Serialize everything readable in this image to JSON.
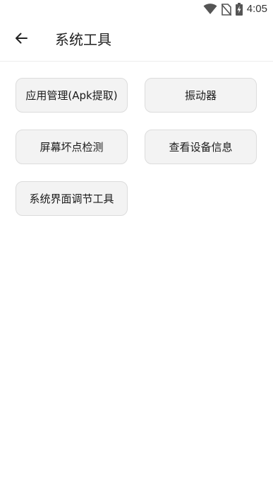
{
  "status_bar": {
    "time": "4:05",
    "icons": [
      "wifi-icon",
      "no-sim-icon",
      "battery-charging-icon"
    ]
  },
  "header": {
    "title": "系统工具",
    "back_icon": "arrow-left-icon"
  },
  "tools": [
    {
      "label": "应用管理(Apk提取)"
    },
    {
      "label": "振动器"
    },
    {
      "label": "屏幕坏点检测"
    },
    {
      "label": "查看设备信息"
    },
    {
      "label": "系统界面调节工具"
    }
  ],
  "colors": {
    "background": "#ffffff",
    "button_bg": "#f3f3f3",
    "button_border": "#dcdcdc",
    "text": "#1a1a1a"
  }
}
